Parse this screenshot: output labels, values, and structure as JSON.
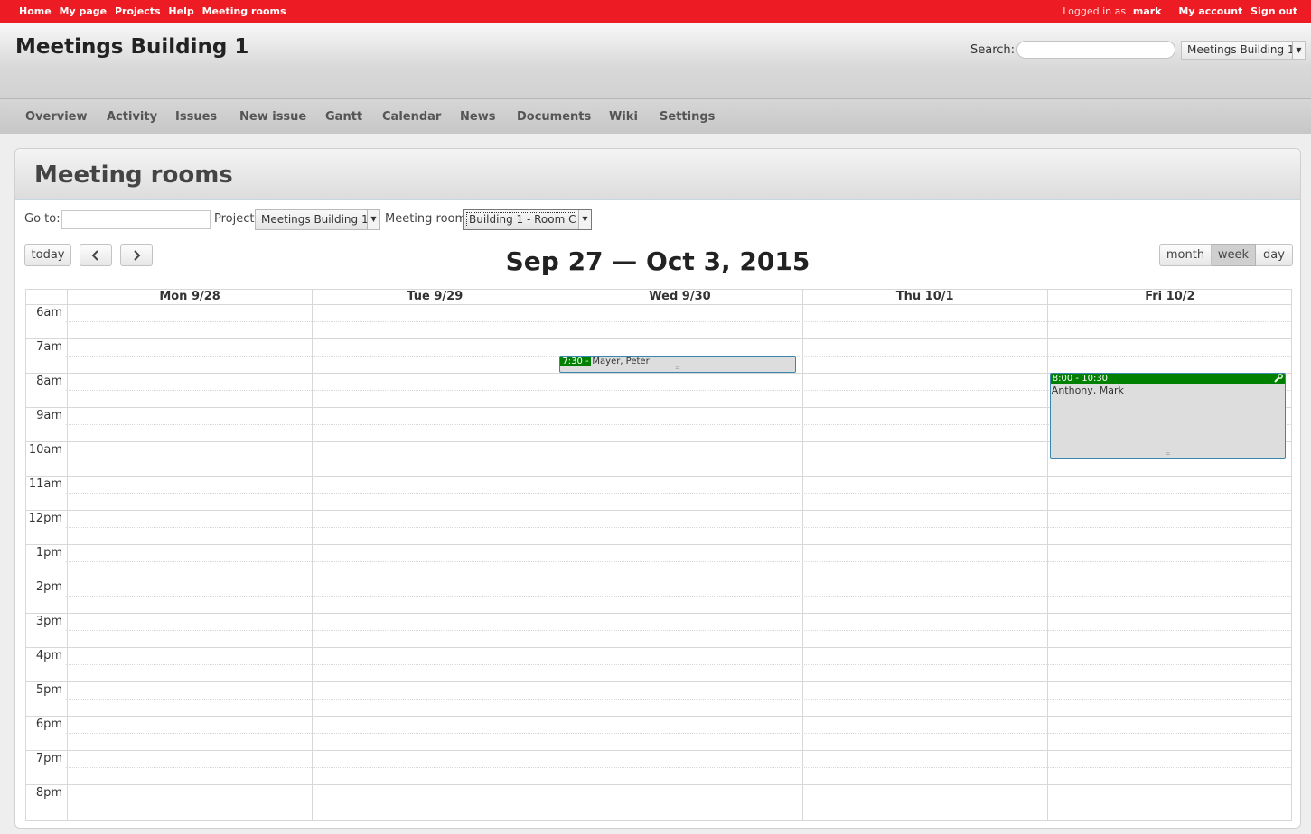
{
  "top_menu": {
    "links": [
      "Home",
      "My page",
      "Projects",
      "Help",
      "Meeting rooms"
    ],
    "logged_in_prefix": "Logged in as",
    "username": "mark",
    "my_account": "My account",
    "sign_out": "Sign out"
  },
  "header": {
    "project_title": "Meetings Building 1",
    "search_label": "Search:",
    "search_value": "",
    "project_jump_value": "Meetings Building 1"
  },
  "main_menu": {
    "tabs": [
      "Overview",
      "Activity",
      "Issues",
      "New issue",
      "Gantt",
      "Calendar",
      "News",
      "Documents",
      "Wiki",
      "Settings"
    ]
  },
  "page": {
    "title": "Meeting rooms",
    "goto_label": "Go to:",
    "goto_value": "",
    "project_label": "Project",
    "project_value": "Meetings Building 1",
    "room_label": "Meeting room",
    "room_value": "Building 1 - Room C"
  },
  "toolbar": {
    "today": "today",
    "prev_icon": "chevron-left-icon",
    "next_icon": "chevron-right-icon",
    "range_title": "Sep 27 — Oct 3, 2015",
    "views": [
      "month",
      "week",
      "day"
    ],
    "active_view": "week"
  },
  "calendar": {
    "days": [
      "Mon 9/28",
      "Tue 9/29",
      "Wed 9/30",
      "Thu 10/1",
      "Fri 10/2"
    ],
    "hours": [
      "6am",
      "7am",
      "8am",
      "9am",
      "10am",
      "11am",
      "12pm",
      "1pm",
      "2pm",
      "3pm",
      "4pm",
      "5pm",
      "6pm",
      "7pm",
      "8pm"
    ],
    "events": [
      {
        "day": "Wed 9/30",
        "time_label": "7:30 -",
        "title": "Mayer, Peter",
        "start_hour": 7.5,
        "end_hour": 8.0,
        "color": "#008000"
      },
      {
        "day": "Fri 10/2",
        "time_label": "8:00 - 10:30",
        "title": "Anthony, Mark",
        "start_hour": 8.0,
        "end_hour": 10.5,
        "color": "#008000",
        "icon": "wrench-icon"
      }
    ]
  },
  "colors": {
    "top_bar": "#ed1c24",
    "event_header": "#008000",
    "event_border": "#3a87ad"
  }
}
